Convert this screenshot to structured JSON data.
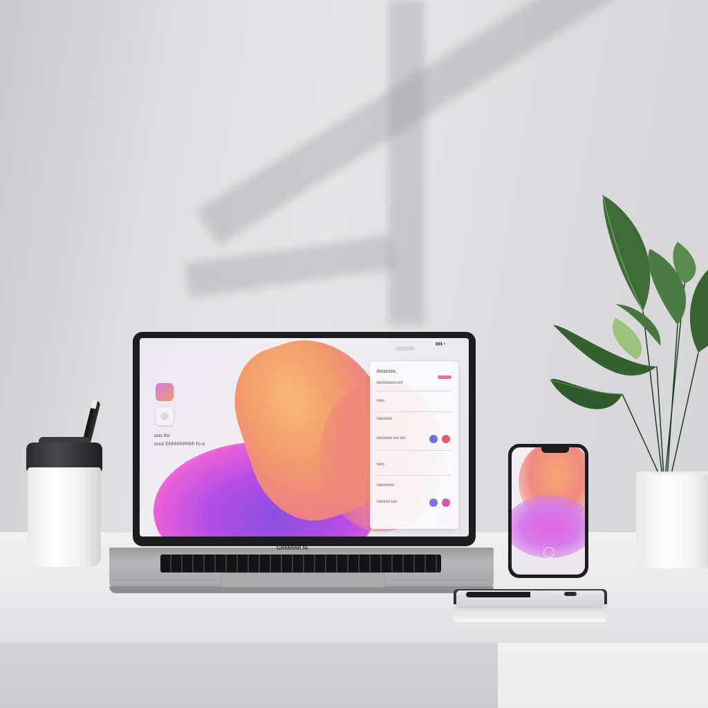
{
  "scene": {
    "description_colors": {
      "wall": "#dedee0",
      "accent_orange": "#f29d6a",
      "accent_purple": "#b44ee6",
      "accent_pink": "#ea5fd7"
    }
  },
  "laptop": {
    "brand_label": "Ghhhhhh fo",
    "screen": {
      "desktop_label_1": "ouu ko",
      "desktop_label_2": "ouul Ghhhhhhhhh fo o",
      "dots": "· · · ·",
      "panel": {
        "title": "Bbbbbbbb",
        "rows": [
          "bbbbbbbbbb bbb",
          "bbbb",
          "bbbbbbbb",
          "bbbbbbbb bbb bbb",
          "bbbb",
          "bbbbbbbbb",
          "bbbbbbb bbb"
        ]
      }
    }
  },
  "phone": {
    "dots": "· ·"
  },
  "icons": {
    "app_icon_gradient": "gradient-app-icon",
    "app_icon_white": "white-app-icon"
  }
}
